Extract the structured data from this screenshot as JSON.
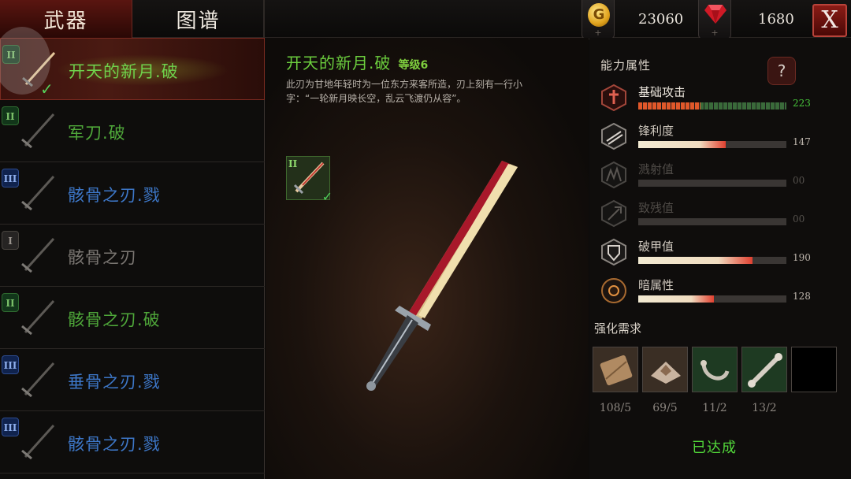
{
  "tabs": {
    "weapons": "武器",
    "recipes": "图谱"
  },
  "currency": {
    "coin_symbol": "G",
    "coins": "23060",
    "gems": "1680"
  },
  "close_label": "X",
  "weapon_list": [
    {
      "tier": "II",
      "name": "开天的新月.破",
      "color": "green",
      "selected": true,
      "equipped": true
    },
    {
      "tier": "II",
      "name": "军刀.破",
      "color": "green"
    },
    {
      "tier": "III",
      "name": "骸骨之刃.戮",
      "color": "blue"
    },
    {
      "tier": "I",
      "name": "骸骨之刃",
      "color": "gray"
    },
    {
      "tier": "II",
      "name": "骸骨之刃.破",
      "color": "green"
    },
    {
      "tier": "III",
      "name": "垂骨之刃.戮",
      "color": "blue"
    },
    {
      "tier": "III",
      "name": "骸骨之刃.戮",
      "color": "blue"
    }
  ],
  "detail": {
    "title": "开天的新月.破",
    "level": "等级6",
    "description": "此刃为甘地年轻时为一位东方来客所造，刃上刻有一行小字：“一轮新月映长空，乱云飞渡仍从容”。",
    "badge": "II"
  },
  "stats": {
    "title": "能力属性",
    "help": "?",
    "items": [
      {
        "label": "基础攻击",
        "value": "223",
        "fill": 0.42,
        "type": "attack",
        "active": true
      },
      {
        "label": "锋利度",
        "value": "147",
        "fill": 0.59,
        "type": "sharp",
        "active": true
      },
      {
        "label": "溅射值",
        "value": "00",
        "fill": 0,
        "type": "splash",
        "active": false
      },
      {
        "label": "致残值",
        "value": "00",
        "fill": 0,
        "type": "cripple",
        "active": false
      },
      {
        "label": "破甲值",
        "value": "190",
        "fill": 0.77,
        "type": "pierce",
        "active": true
      },
      {
        "label": "暗属性",
        "value": "128",
        "fill": 0.51,
        "type": "dark",
        "active": true
      }
    ]
  },
  "requirements": {
    "title": "强化需求",
    "items": [
      {
        "icon": "wood-plank-icon",
        "count": "108/5"
      },
      {
        "icon": "ore-icon",
        "count": "69/5"
      },
      {
        "icon": "claw-icon",
        "count": "11/2"
      },
      {
        "icon": "bone-icon",
        "count": "13/2"
      },
      {
        "icon": "empty-slot",
        "count": ""
      }
    ],
    "status": "已达成"
  },
  "colors": {
    "accent_red": "#8a1c16",
    "green_text": "#4fa83a",
    "blue_text": "#3d77c8",
    "reached_green": "#52d83a"
  }
}
